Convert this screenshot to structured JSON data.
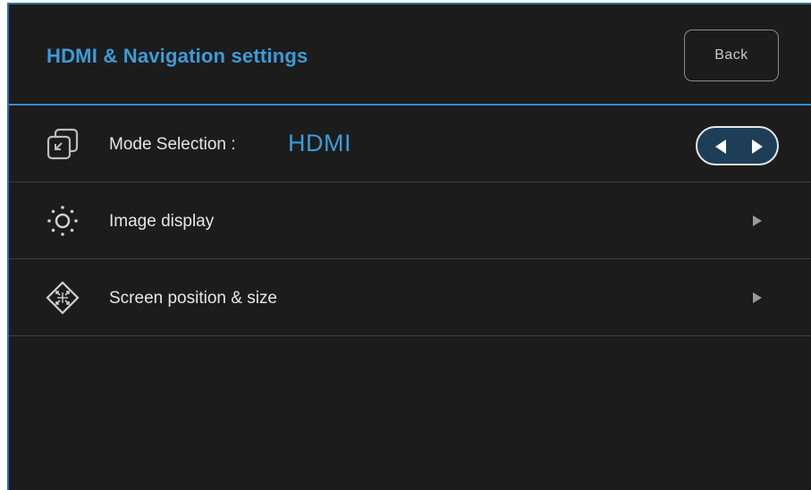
{
  "header": {
    "title": "HDMI & Navigation settings",
    "back_label": "Back"
  },
  "rows": [
    {
      "icon": "source-select-icon",
      "label": "Mode Selection :",
      "value": "HDMI",
      "control": "left-right-stepper"
    },
    {
      "icon": "brightness-icon",
      "label": "Image display",
      "control": "chevron-right-icon"
    },
    {
      "icon": "move-position-icon",
      "label": "Screen position & size",
      "control": "chevron-right-icon"
    }
  ],
  "colors": {
    "background": "#1c1c1c",
    "accent": "#3d9bd9",
    "text": "#e6e6e6",
    "divider": "#3e3e3e",
    "stepper_fill": "#1e3e57"
  }
}
